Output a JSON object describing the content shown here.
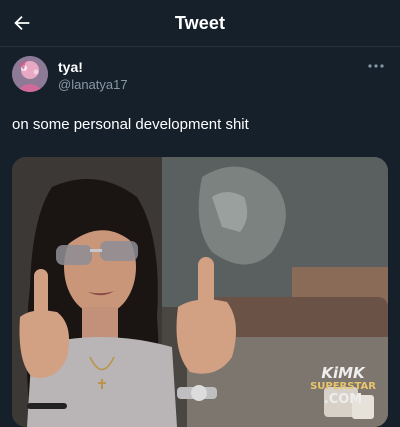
{
  "header": {
    "title": "Tweet",
    "back_icon": "arrow-left-icon"
  },
  "author": {
    "display_name": "tya!",
    "handle": "@lanatya17",
    "avatar_icon": "avatar-image",
    "more_icon": "more-horizontal-icon"
  },
  "tweet": {
    "text": "on some personal development shit"
  },
  "media": {
    "watermark_lines": [
      "KiMK",
      "SUPERSTAR",
      ".COM"
    ]
  },
  "colors": {
    "background": "#15202b",
    "secondary_text": "#8899a6",
    "divider": "#253341"
  }
}
